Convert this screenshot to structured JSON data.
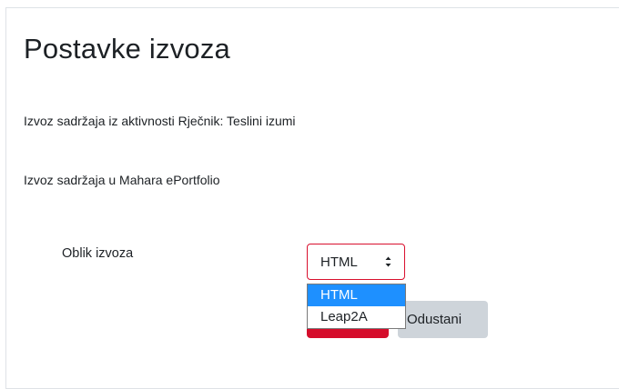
{
  "page": {
    "title": "Postavke izvoza",
    "info_activity": "Izvoz sadržaja iz aktivnosti Rječnik: Teslini izumi",
    "info_target": "Izvoz sadržaja u Mahara ePortfolio"
  },
  "form": {
    "format_label": "Oblik izvoza",
    "format_select": {
      "selected": "HTML",
      "options": [
        "HTML",
        "Leap2A"
      ],
      "highlighted_option": "HTML"
    },
    "cancel_label": "Odustani"
  },
  "colors": {
    "accent": "#d50d2b",
    "select_border": "#d9102e",
    "option_highlight": "#1e90ff",
    "cancel_bg": "#ced4da",
    "panel_border": "#dee2e6"
  }
}
